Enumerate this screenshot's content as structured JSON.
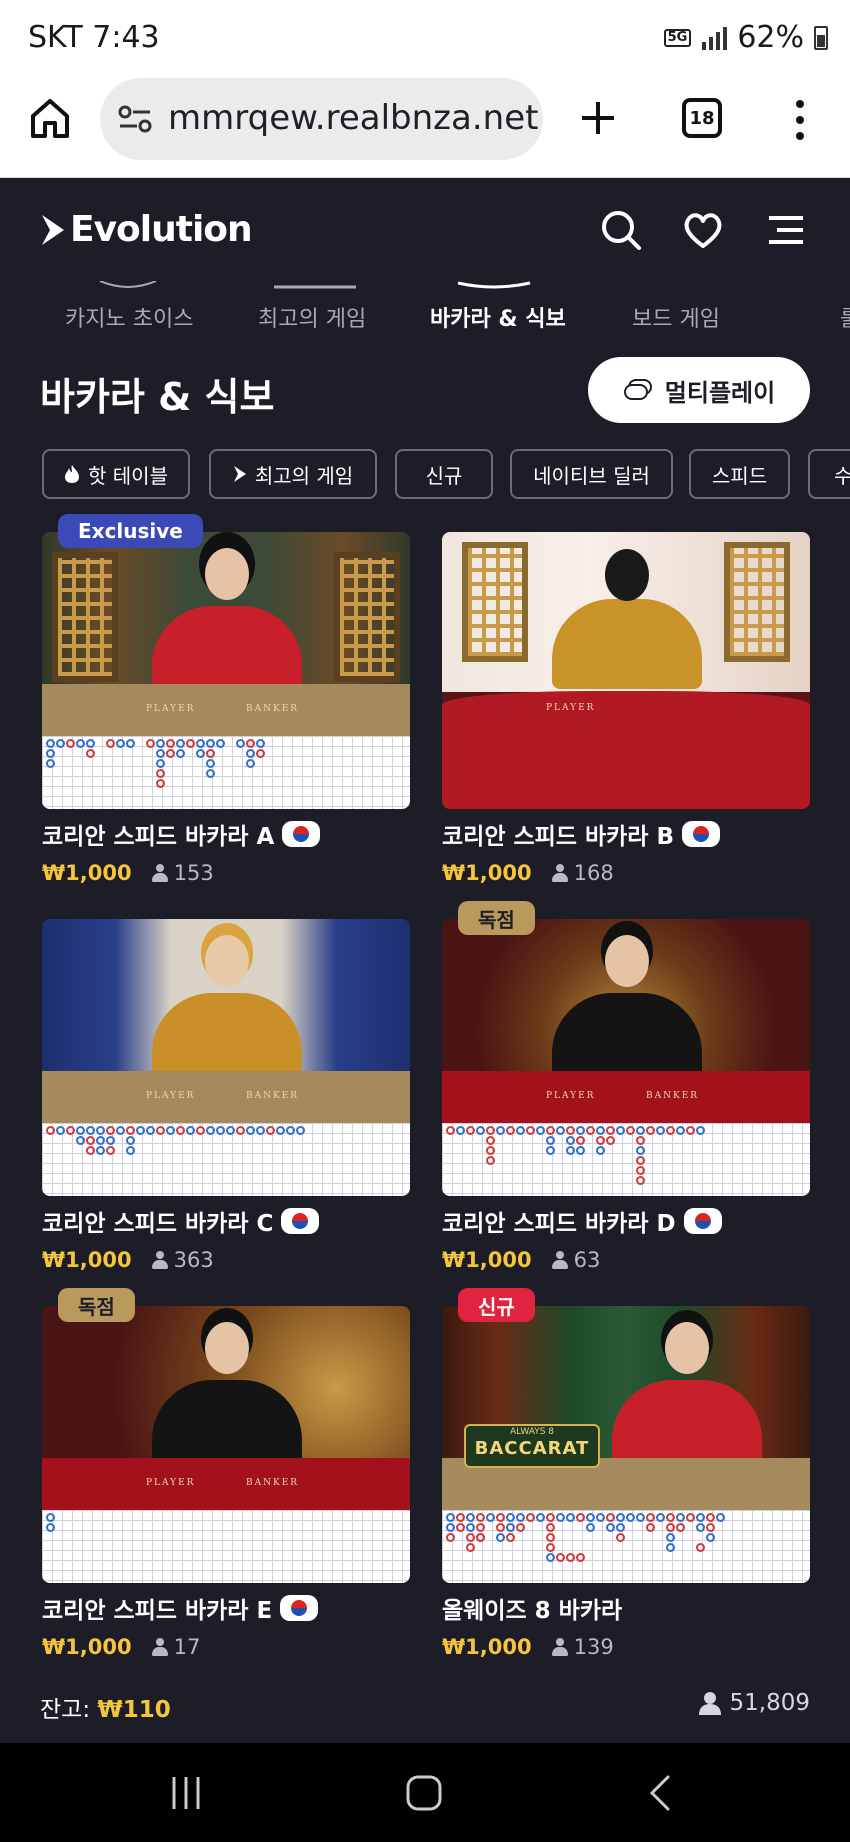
{
  "status_bar": {
    "time": "SKT 7:43",
    "network": "5G",
    "battery": "62%"
  },
  "browser": {
    "url": "mmrqew.realbnza.net",
    "tab_count": "18"
  },
  "site": {
    "logo": "Evolution"
  },
  "categories": [
    {
      "label": "카지노 초이스",
      "active": false
    },
    {
      "label": "최고의 게임",
      "active": false
    },
    {
      "label": "바카라 & 식보",
      "active": true
    },
    {
      "label": "보드 게임",
      "active": false
    },
    {
      "label": "룰",
      "active": false
    }
  ],
  "page": {
    "title": "바카라 & 식보",
    "multiplay_label": "멀티플레이"
  },
  "filters": [
    "핫 테이블",
    "최고의 게임",
    "신규",
    "네이티브 딜러",
    "스피드",
    "수"
  ],
  "cards": [
    {
      "title": "코리안 스피드 바카라 A",
      "badge": "Exclusive",
      "price": "₩1,000",
      "players": "153"
    },
    {
      "title": "코리안 스피드 바카라 B",
      "badge": "",
      "price": "₩1,000",
      "players": "168"
    },
    {
      "title": "코리안 스피드 바카라 C",
      "badge": "",
      "price": "₩1,000",
      "players": "363"
    },
    {
      "title": "코리안 스피드 바카라 D",
      "badge": "독점",
      "price": "₩1,000",
      "players": "63"
    },
    {
      "title": "코리안 스피드 바카라 E",
      "badge": "독점",
      "price": "₩1,000",
      "players": "17"
    },
    {
      "title": "올웨이즈 8 바카라",
      "badge": "신규",
      "price": "₩1,000",
      "players": "139"
    }
  ],
  "scene_text": {
    "player": "PLAYER",
    "banker": "BANKER",
    "always8_top": "ALWAYS 8",
    "baccarat": "BACCARAT"
  },
  "footer": {
    "balance_label": "잔고:",
    "balance_amount": "₩110",
    "online_count": "51,809"
  },
  "colors": {
    "background": "#1c1d26",
    "accent_gold": "#f6c53d",
    "exclusive_badge": "#3c4ab8",
    "dokjeom_badge": "#b99a5c",
    "new_badge": "#e0243f"
  }
}
